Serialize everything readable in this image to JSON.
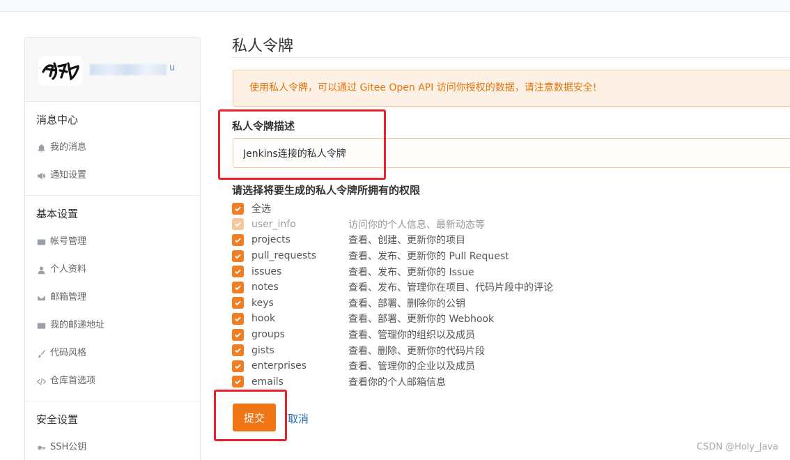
{
  "sidebar": {
    "username_tail": "u",
    "sections": [
      {
        "title": "消息中心",
        "items": [
          {
            "label": "我的消息",
            "icon": "bell-icon"
          },
          {
            "label": "通知设置",
            "icon": "volume-icon"
          }
        ]
      },
      {
        "title": "基本设置",
        "items": [
          {
            "label": "帐号管理",
            "icon": "id-card-icon"
          },
          {
            "label": "个人资料",
            "icon": "user-icon"
          },
          {
            "label": "邮箱管理",
            "icon": "envelope-icon"
          },
          {
            "label": "我的邮递地址",
            "icon": "address-card-icon"
          },
          {
            "label": "代码风格",
            "icon": "brush-icon"
          },
          {
            "label": "仓库首选项",
            "icon": "code-icon"
          }
        ]
      },
      {
        "title": "安全设置",
        "items": [
          {
            "label": "SSH公钥",
            "icon": "key-icon"
          }
        ]
      }
    ]
  },
  "main": {
    "title": "私人令牌",
    "alert": "使用私人令牌，可以通过 Gitee Open API 访问你授权的数据，请注意数据安全!",
    "description_label": "私人令牌描述",
    "description_value": "Jenkins连接的私人令牌",
    "permissions_label": "请选择将要生成的私人令牌所拥有的权限",
    "permissions": [
      {
        "name": "全选",
        "desc": "",
        "checked": true,
        "disabled": false
      },
      {
        "name": "user_info",
        "desc": "访问你的个人信息、最新动态等",
        "checked": true,
        "disabled": true
      },
      {
        "name": "projects",
        "desc": "查看、创建、更新你的项目",
        "checked": true,
        "disabled": false
      },
      {
        "name": "pull_requests",
        "desc": "查看、发布、更新你的 Pull Request",
        "checked": true,
        "disabled": false
      },
      {
        "name": "issues",
        "desc": "查看、发布、更新你的 Issue",
        "checked": true,
        "disabled": false
      },
      {
        "name": "notes",
        "desc": "查看、发布、管理你在项目、代码片段中的评论",
        "checked": true,
        "disabled": false
      },
      {
        "name": "keys",
        "desc": "查看、部署、删除你的公钥",
        "checked": true,
        "disabled": false
      },
      {
        "name": "hook",
        "desc": "查看、部署、更新你的 Webhook",
        "checked": true,
        "disabled": false
      },
      {
        "name": "groups",
        "desc": "查看、管理你的组织以及成员",
        "checked": true,
        "disabled": false
      },
      {
        "name": "gists",
        "desc": "查看、删除、更新你的代码片段",
        "checked": true,
        "disabled": false
      },
      {
        "name": "enterprises",
        "desc": "查看、管理你的企业以及成员",
        "checked": true,
        "disabled": false
      },
      {
        "name": "emails",
        "desc": "查看你的个人邮箱信息",
        "checked": true,
        "disabled": false
      }
    ],
    "submit_label": "提交",
    "cancel_label": "取消"
  },
  "watermark": "CSDN @Holy_Java",
  "colors": {
    "accent": "#f17415",
    "alert_text": "#e4750d",
    "link": "#2b6fb6",
    "annotation": "#e8222a"
  }
}
